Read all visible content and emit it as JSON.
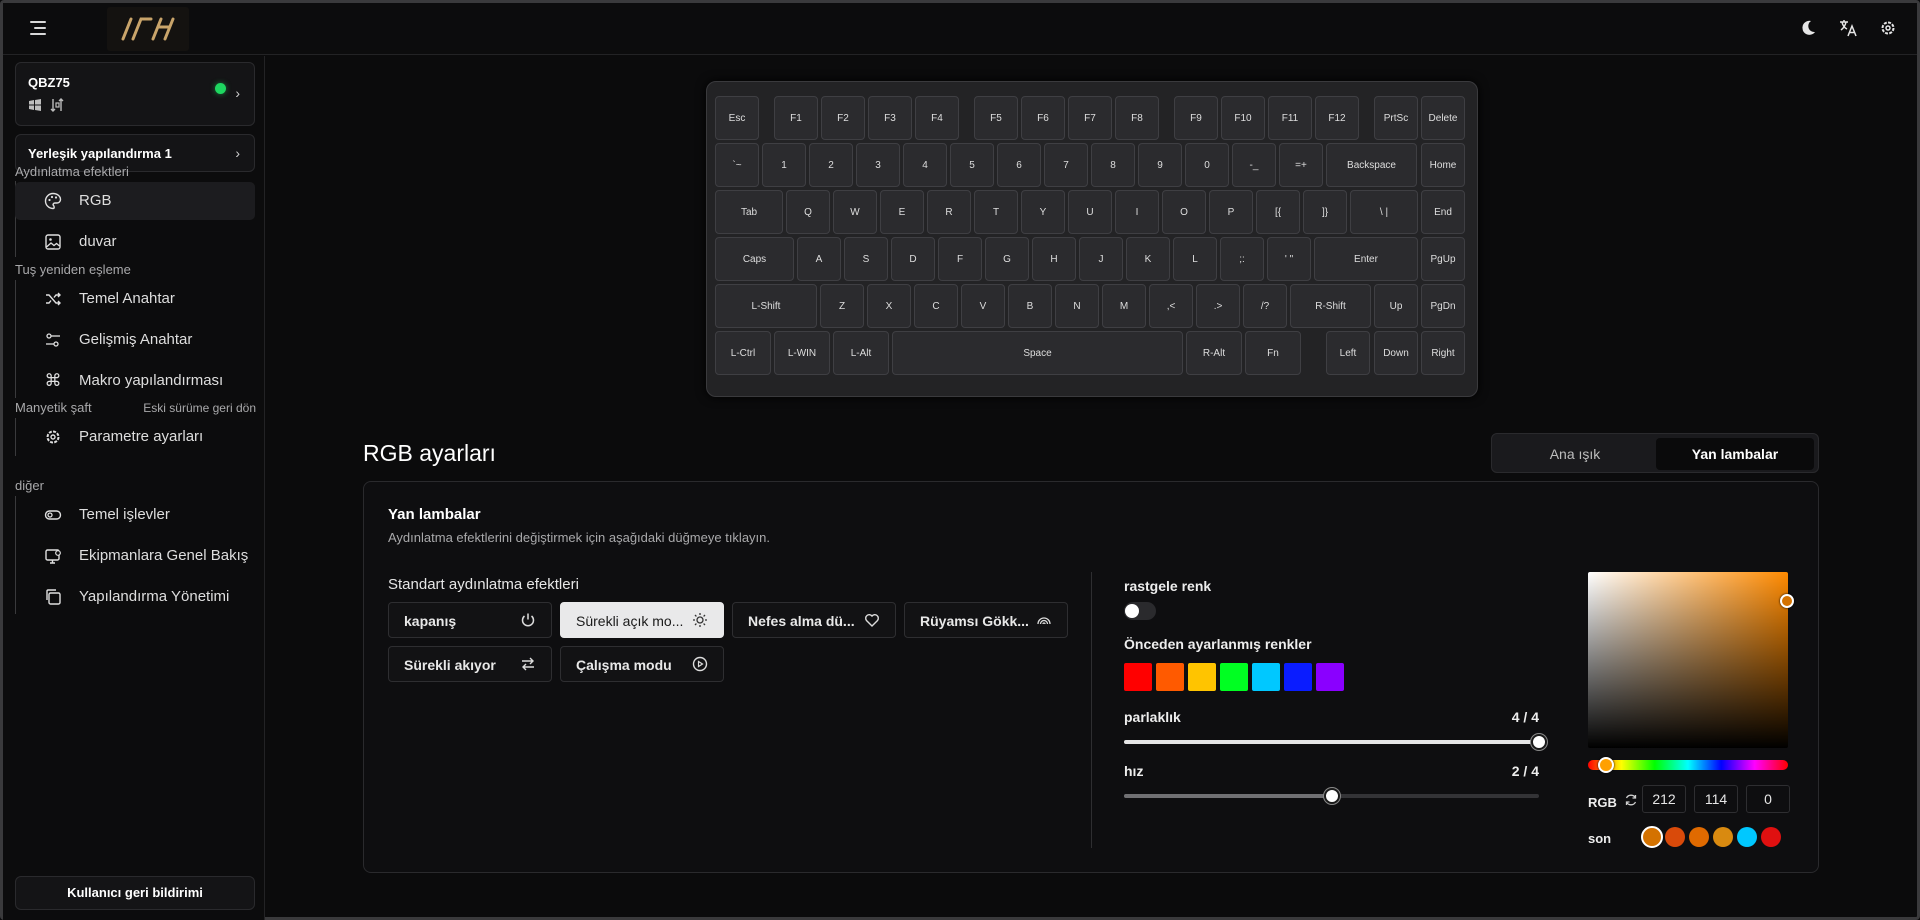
{
  "header": {
    "icons": [
      "menu-icon",
      "moon-icon",
      "translate-icon",
      "gear-icon"
    ]
  },
  "sidebar": {
    "device": {
      "name": "QBZ75",
      "status_color": "#1ed760",
      "icons": [
        "windows-icon",
        "connection-icon"
      ]
    },
    "config": {
      "label": "Yerleşik yapılandırma 1"
    },
    "sections": [
      {
        "label": "Aydınlatma efektleri",
        "items": [
          {
            "label": "RGB",
            "icon": "palette-icon"
          },
          {
            "label": "duvar",
            "icon": "image-icon"
          }
        ]
      },
      {
        "label": "Tuş yeniden eşleme",
        "items": [
          {
            "label": "Temel Anahtar",
            "icon": "shuffle-icon"
          },
          {
            "label": "Gelişmiş Anahtar",
            "icon": "sliders-icon"
          },
          {
            "label": "Makro yapılandırması",
            "icon": "command-icon"
          }
        ]
      },
      {
        "label": "Manyetik şaft",
        "right": "Eski sürüme geri dön",
        "items": [
          {
            "label": "Parametre ayarları",
            "icon": "gear-icon"
          }
        ]
      },
      {
        "label": "diğer",
        "items": [
          {
            "label": "Temel işlevler",
            "icon": "toggle-icon"
          },
          {
            "label": "Ekipmanlara Genel Bakış",
            "icon": "monitor-icon"
          },
          {
            "label": "Yapılandırma Yönetimi",
            "icon": "copy-icon"
          }
        ]
      }
    ],
    "feedback": "Kullanıcı geri bildirimi"
  },
  "keyboard": {
    "rows": [
      [
        "Esc",
        "F1",
        "F2",
        "F3",
        "F4",
        "F5",
        "F6",
        "F7",
        "F8",
        "F9",
        "F10",
        "F11",
        "F12",
        "PrtSc",
        "Delete"
      ],
      [
        "`~",
        "1",
        "2",
        "3",
        "4",
        "5",
        "6",
        "7",
        "8",
        "9",
        "0",
        "-_",
        "=+",
        "Backspace",
        "Home"
      ],
      [
        "Tab",
        "Q",
        "W",
        "E",
        "R",
        "T",
        "Y",
        "U",
        "I",
        "O",
        "P",
        "[{",
        "]}",
        "\\ |",
        "End"
      ],
      [
        "Caps",
        "A",
        "S",
        "D",
        "F",
        "G",
        "H",
        "J",
        "K",
        "L",
        ";:",
        "' \"",
        "Enter",
        "PgUp"
      ],
      [
        "L-Shift",
        "Z",
        "X",
        "C",
        "V",
        "B",
        "N",
        "M",
        ",<",
        ".>",
        "/?",
        "R-Shift",
        "Up",
        "PgDn"
      ],
      [
        "L-Ctrl",
        "L-WIN",
        "L-Alt",
        "Space",
        "R-Alt",
        "Fn",
        "Left",
        "Down",
        "Right"
      ]
    ]
  },
  "rgb": {
    "title": "RGB ayarları",
    "tabs": [
      "Ana ışık",
      "Yan lambalar"
    ],
    "panel_title": "Yan lambalar",
    "panel_subtitle": "Aydınlatma efektlerini değiştirmek için aşağıdaki düğmeye tıklayın.",
    "effects_title": "Standart aydınlatma efektleri",
    "effects": [
      {
        "label": "kapanış",
        "icon": "power-icon"
      },
      {
        "label": "Sürekli açık mo...",
        "icon": "sun-icon"
      },
      {
        "label": "Nefes alma dü...",
        "icon": "heart-icon"
      },
      {
        "label": "Rüyamsı Gökk...",
        "icon": "rainbow-icon"
      },
      {
        "label": "Sürekli akıyor",
        "icon": "arrows-swap-icon"
      },
      {
        "label": "Çalışma modu",
        "icon": "play-circle-icon"
      }
    ],
    "random_color": {
      "label": "rastgele renk",
      "on": false
    },
    "preset_title": "Önceden ayarlanmış renkler",
    "presets": [
      "#ff0000",
      "#ff5a00",
      "#ffc400",
      "#00ff22",
      "#00c8ff",
      "#0a1cff",
      "#8a00ff"
    ],
    "brightness": {
      "label": "parlaklık",
      "display": "4 / 4",
      "value": 4,
      "max": 4
    },
    "speed": {
      "label": "hız",
      "display": "2 / 4",
      "value": 2,
      "max": 4
    },
    "picker": {
      "hex": "#d47200",
      "rgb_label": "RGB",
      "r": "212",
      "g": "114",
      "b": "0",
      "recent_label": "son",
      "recent": [
        "#d47200",
        "#d94a0a",
        "#e06a00",
        "#d98a10",
        "#00c8ff",
        "#e01010"
      ]
    }
  }
}
